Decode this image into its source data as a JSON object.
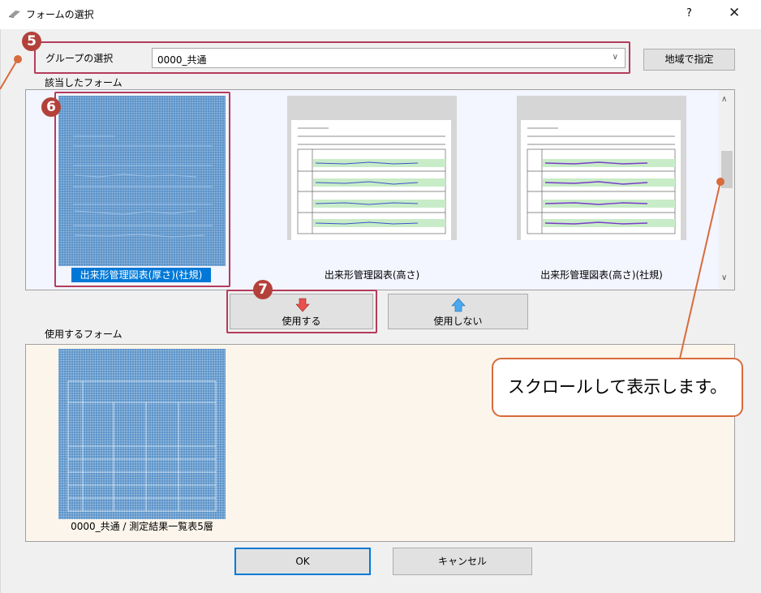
{
  "window": {
    "title": "フォームの選択",
    "help_glyph": "?",
    "close_glyph": "✕"
  },
  "group": {
    "label": "グループの選択",
    "value": "0000_共通",
    "region_button": "地域で指定"
  },
  "matched_label": "該当したフォーム",
  "thumbnails": [
    {
      "caption": "出来形管理図表(厚さ)(社規)",
      "selected": true
    },
    {
      "caption": "出来形管理図表(高さ)",
      "selected": false
    },
    {
      "caption": "出来形管理図表(高さ)(社規)",
      "selected": false
    }
  ],
  "buttons": {
    "use": "使用する",
    "unuse": "使用しない",
    "ok": "OK",
    "cancel": "キャンセル"
  },
  "used_label": "使用するフォーム",
  "used_forms": [
    {
      "caption": "0000_共通 / 測定結果一覧表5層"
    }
  ],
  "annotations": {
    "badge5": "5",
    "badge6": "6",
    "badge7": "7",
    "callout": "スクロールして表示します。"
  },
  "colors": {
    "accent": "#b3413a",
    "callout_border": "#d86b3c",
    "selection": "#0078d7"
  }
}
